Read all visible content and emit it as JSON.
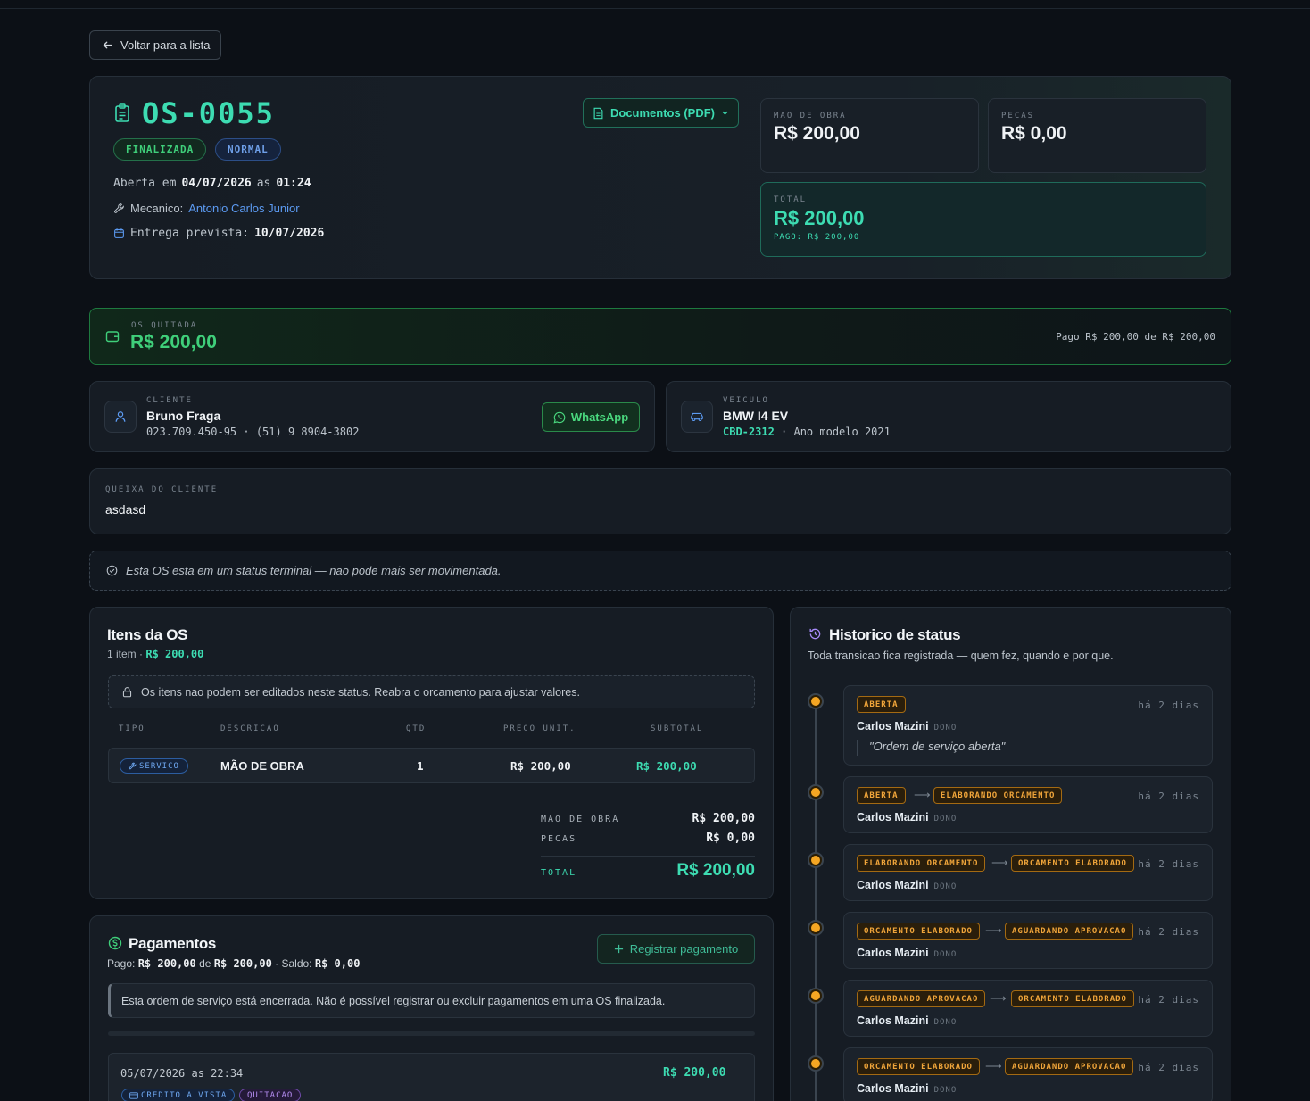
{
  "nav": {
    "back_label": "Voltar para a lista"
  },
  "os": {
    "number": "OS-0055",
    "status": "FINALIZADA",
    "priority": "NORMAL",
    "opened_prefix": "Aberta em",
    "opened_date": "04/07/2026",
    "opened_sep": "as",
    "opened_time": "01:24",
    "mechanic_label": "Mecanico:",
    "mechanic_name": "Antonio Carlos Junior",
    "delivery_label": "Entrega prevista:",
    "delivery_date": "10/07/2026",
    "documents_label": "Documentos (PDF)"
  },
  "totals": {
    "labor_label": "MAO DE OBRA",
    "labor_value": "R$ 200,00",
    "parts_label": "PECAS",
    "parts_value": "R$ 0,00",
    "total_label": "TOTAL",
    "total_value": "R$ 200,00",
    "paid_text": "PAGO: R$ 200,00"
  },
  "paid_banner": {
    "label": "OS QUITADA",
    "value": "R$ 200,00",
    "summary": "Pago R$ 200,00 de R$ 200,00"
  },
  "client": {
    "label": "CLIENTE",
    "name": "Bruno Fraga",
    "details": "023.709.450-95 · (51) 9 8904-3802",
    "whatsapp_label": "WhatsApp"
  },
  "vehicle": {
    "label": "VEICULO",
    "model": "BMW I4 EV",
    "plate": "CBD-2312",
    "year": "· Ano modelo 2021"
  },
  "complaint": {
    "label": "QUEIXA DO CLIENTE",
    "text": "asdasd"
  },
  "terminal_notice": "Esta OS esta em um status terminal — nao pode mais ser movimentada.",
  "items": {
    "title": "Itens da OS",
    "count": "1 item ·",
    "count_total": "R$ 200,00",
    "notice": "Os itens nao podem ser editados neste status. Reabra o orcamento para ajustar valores.",
    "headers": [
      "TIPO",
      "DESCRICAO",
      "QTD",
      "PRECO UNIT.",
      "SUBTOTAL"
    ],
    "rows": [
      {
        "type": "SERVICO",
        "description": "MÃO DE OBRA",
        "qty": "1",
        "unit_price": "R$ 200,00",
        "subtotal": "R$ 200,00"
      }
    ],
    "sum_labor_label": "MAO DE OBRA",
    "sum_labor": "R$ 200,00",
    "sum_parts_label": "PECAS",
    "sum_parts": "R$ 0,00",
    "sum_total_label": "TOTAL",
    "sum_total": "R$ 200,00"
  },
  "payments": {
    "title": "Pagamentos",
    "summary_paid_label": "Pago:",
    "summary_paid": "R$ 200,00",
    "summary_of": "de",
    "summary_total": "R$ 200,00",
    "summary_balance_label": "· Saldo:",
    "summary_balance": "R$ 0,00",
    "register_label": "Registrar pagamento",
    "closed_notice": "Esta ordem de serviço está encerrada. Não é possível registrar ou excluir pagamentos em uma OS finalizada.",
    "entries": [
      {
        "datetime": "05/07/2026 as 22:34",
        "amount": "R$ 200,00",
        "method": "CREDITO A VISTA",
        "kind": "QUITACAO"
      }
    ]
  },
  "history": {
    "title": "Historico de status",
    "subtitle": "Toda transicao fica registrada — quem fez, quando e por que.",
    "entries": [
      {
        "from": "ABERTA",
        "to": "",
        "ago": "há 2 dias",
        "user": "Carlos Mazini",
        "role": "DONO",
        "note": "\"Ordem de serviço aberta\""
      },
      {
        "from": "ABERTA",
        "to": "ELABORANDO ORCAMENTO",
        "ago": "há 2 dias",
        "user": "Carlos Mazini",
        "role": "DONO"
      },
      {
        "from": "ELABORANDO ORCAMENTO",
        "to": "ORCAMENTO ELABORADO",
        "ago": "há 2 dias",
        "user": "Carlos Mazini",
        "role": "DONO"
      },
      {
        "from": "ORCAMENTO ELABORADO",
        "to": "AGUARDANDO APROVACAO",
        "ago": "há 2 dias",
        "user": "Carlos Mazini",
        "role": "DONO"
      },
      {
        "from": "AGUARDANDO APROVACAO",
        "to": "ORCAMENTO ELABORADO",
        "ago": "há 2 dias",
        "user": "Carlos Mazini",
        "role": "DONO"
      },
      {
        "from": "ORCAMENTO ELABORADO",
        "to": "AGUARDANDO APROVACAO",
        "ago": "há 2 dias",
        "user": "Carlos Mazini",
        "role": "DONO"
      }
    ]
  },
  "colors": {
    "accent": "#3ddcb2",
    "success": "#3fcf7a",
    "link": "#5c9bf3",
    "status_pill": "#f0a53a"
  }
}
